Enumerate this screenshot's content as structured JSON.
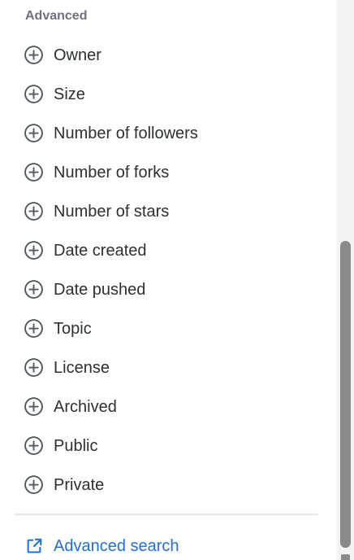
{
  "section": {
    "heading": "Advanced"
  },
  "filters": [
    {
      "label": "Owner",
      "icon": "plus-circle-icon"
    },
    {
      "label": "Size",
      "icon": "plus-circle-icon"
    },
    {
      "label": "Number of followers",
      "icon": "plus-circle-icon"
    },
    {
      "label": "Number of forks",
      "icon": "plus-circle-icon"
    },
    {
      "label": "Number of stars",
      "icon": "plus-circle-icon"
    },
    {
      "label": "Date created",
      "icon": "plus-circle-icon"
    },
    {
      "label": "Date pushed",
      "icon": "plus-circle-icon"
    },
    {
      "label": "Topic",
      "icon": "plus-circle-icon"
    },
    {
      "label": "License",
      "icon": "plus-circle-icon"
    },
    {
      "label": "Archived",
      "icon": "plus-circle-icon"
    },
    {
      "label": "Public",
      "icon": "plus-circle-icon"
    },
    {
      "label": "Private",
      "icon": "plus-circle-icon"
    }
  ],
  "footer": {
    "advanced_search_label": "Advanced search",
    "advanced_search_icon": "external-link-icon"
  },
  "colors": {
    "heading": "#6b7280",
    "text": "#2b2f36",
    "icon": "#4b5563",
    "link": "#1f6fd6",
    "divider": "#e5e7eb"
  }
}
